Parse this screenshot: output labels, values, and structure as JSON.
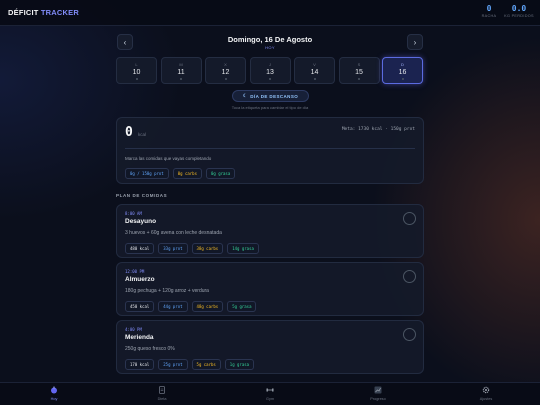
{
  "app": {
    "brand_main": "DÉFICIT",
    "brand_accent": "TRACKER",
    "stats": [
      {
        "value": "0",
        "label": "RACHA"
      },
      {
        "value": "0.0",
        "label": "KG PERDIDOS"
      }
    ]
  },
  "date_nav": {
    "prev_icon": "‹",
    "next_icon": "›",
    "title": "Domingo, 16 De Agosto",
    "subtitle": "HOY"
  },
  "days": [
    {
      "letter": "L",
      "number": "10",
      "active": false
    },
    {
      "letter": "M",
      "number": "11",
      "active": false
    },
    {
      "letter": "X",
      "number": "12",
      "active": false
    },
    {
      "letter": "J",
      "number": "13",
      "active": false
    },
    {
      "letter": "V",
      "number": "14",
      "active": false
    },
    {
      "letter": "S",
      "number": "15",
      "active": false
    },
    {
      "letter": "D",
      "number": "16",
      "active": true
    }
  ],
  "rest_day": {
    "label": "DÍA DE DESCANSO",
    "hint": "Toca la etiqueta para cambiar el tipo de día"
  },
  "summary": {
    "calories": "0",
    "unit": "kcal",
    "meta": "Meta: 1730 kcal · 150g prot",
    "hint": "Marca las comidas que vayas completando",
    "chips": {
      "prot": "0g / 150g prot",
      "carbs": "0g carbs",
      "fat": "0g grasa"
    }
  },
  "plan": {
    "title": "PLAN DE COMIDAS",
    "meals": [
      {
        "time": "8:00 AM",
        "name": "Desayuno",
        "desc": "3 huevos + 60g avena con leche desnatada",
        "kcal": "480 kcal",
        "prot": "33g prot",
        "carbs": "38g carbs",
        "fat": "14g grasa"
      },
      {
        "time": "12:00 PM",
        "name": "Almuerzo",
        "desc": "180g pechuga + 120g arroz + verdura",
        "kcal": "450 kcal",
        "prot": "44g prot",
        "carbs": "48g carbs",
        "fat": "5g grasa"
      },
      {
        "time": "4:00 PM",
        "name": "Merienda",
        "desc": "250g queso fresco 0%",
        "kcal": "170 kcal",
        "prot": "25g prot",
        "carbs": "5g carbs",
        "fat": "1g grasa"
      }
    ]
  },
  "bottom_nav": [
    {
      "label": "Hoy",
      "icon": "food-icon",
      "active": true
    },
    {
      "label": "Dieta",
      "icon": "document-icon",
      "active": false
    },
    {
      "label": "Gym",
      "icon": "dumbbell-icon",
      "active": false
    },
    {
      "label": "Progreso",
      "icon": "chart-icon",
      "active": false
    },
    {
      "label": "Ajustes",
      "icon": "gear-icon",
      "active": false
    }
  ],
  "colors": {
    "accent": "#818cf8",
    "protein": "#60a5fa",
    "carbs": "#fbbf24",
    "fat": "#34d399",
    "background": "#0b0f1c"
  }
}
